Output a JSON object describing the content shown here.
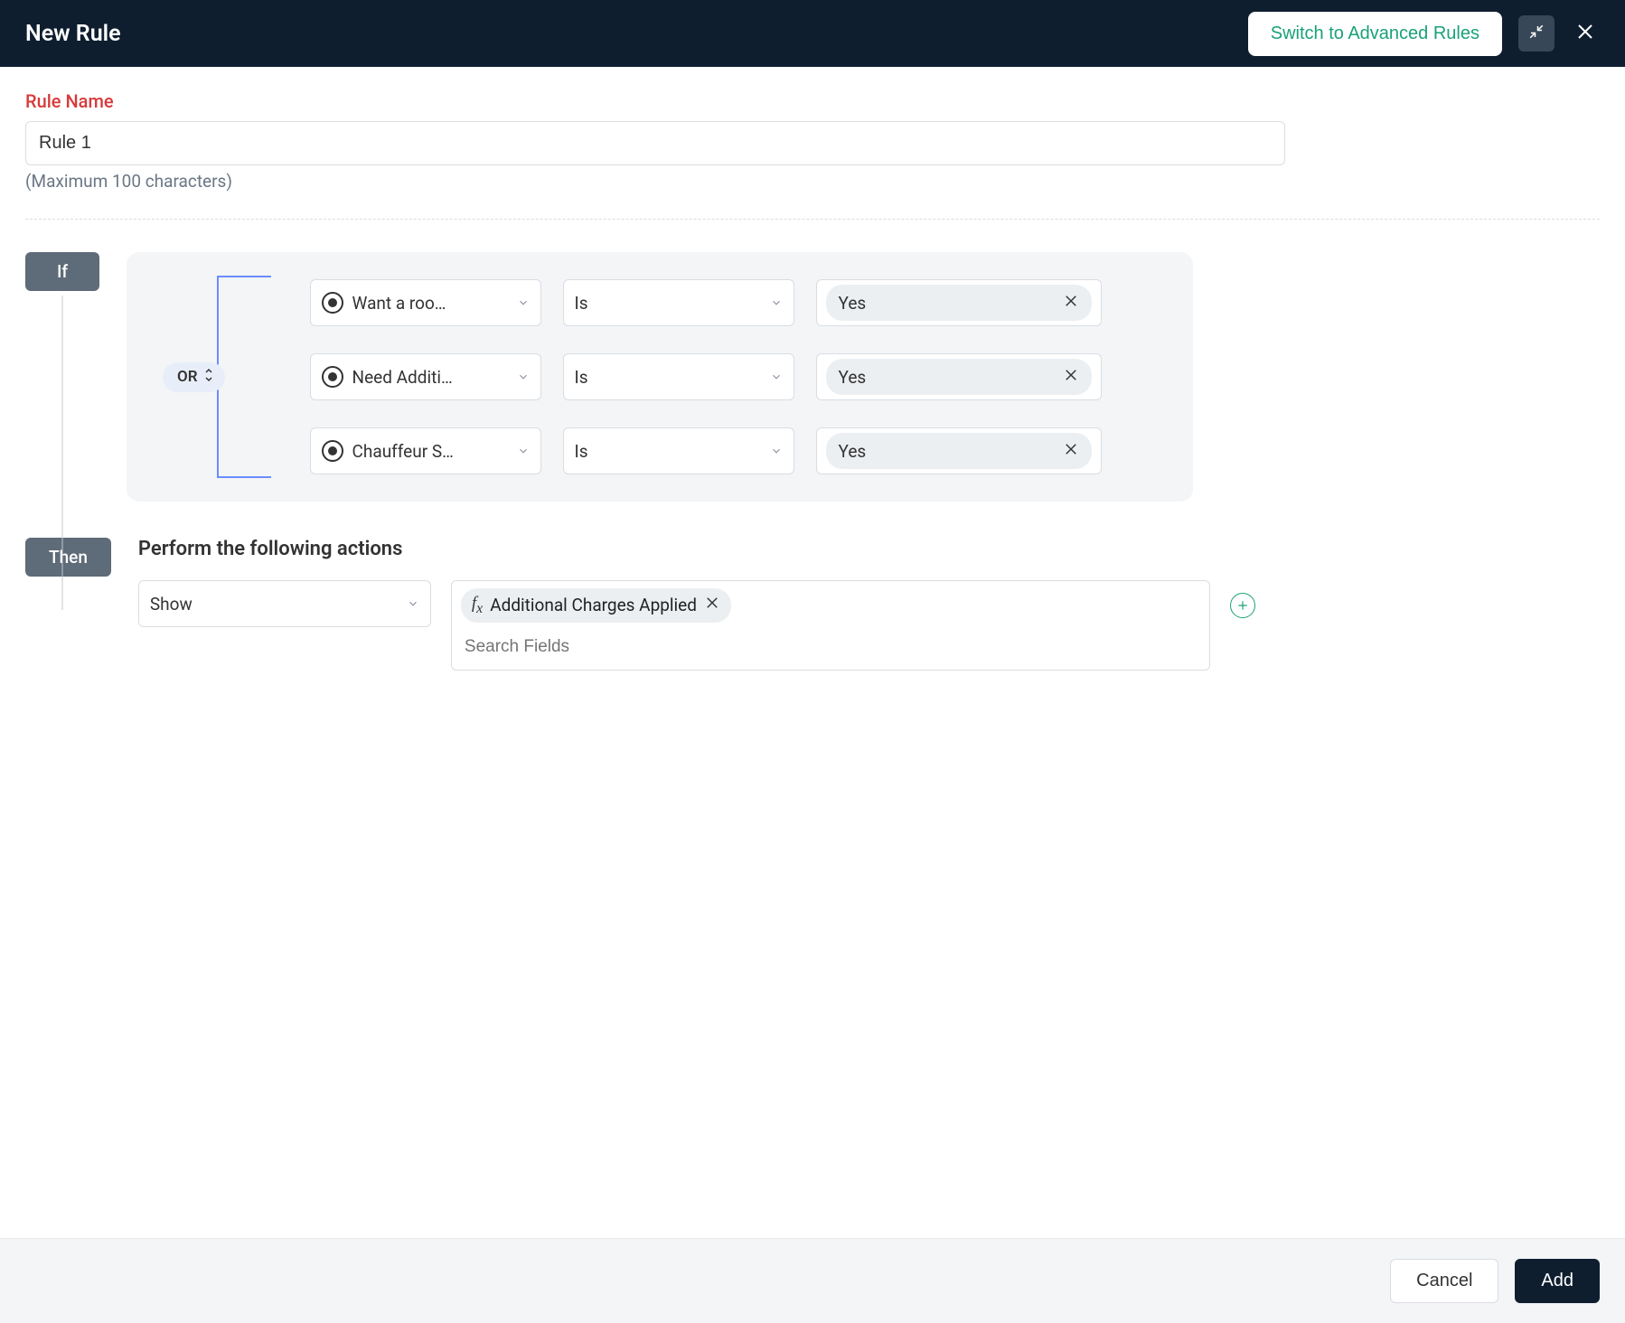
{
  "header": {
    "title": "New Rule",
    "advanced_button": "Switch to Advanced Rules"
  },
  "rule_name": {
    "label": "Rule Name",
    "value": "Rule 1",
    "hint": "(Maximum 100 characters)"
  },
  "if": {
    "chip": "If",
    "logic": "OR",
    "conditions": [
      {
        "field": "Want a roo…",
        "operator": "Is",
        "value": "Yes"
      },
      {
        "field": "Need Additi…",
        "operator": "Is",
        "value": "Yes"
      },
      {
        "field": "Chauffeur S…",
        "operator": "Is",
        "value": "Yes"
      }
    ]
  },
  "then": {
    "chip": "Then",
    "heading": "Perform the following actions",
    "action": "Show",
    "selected_field": "Additional Charges Applied",
    "search_placeholder": "Search Fields"
  },
  "footer": {
    "cancel": "Cancel",
    "add": "Add"
  }
}
